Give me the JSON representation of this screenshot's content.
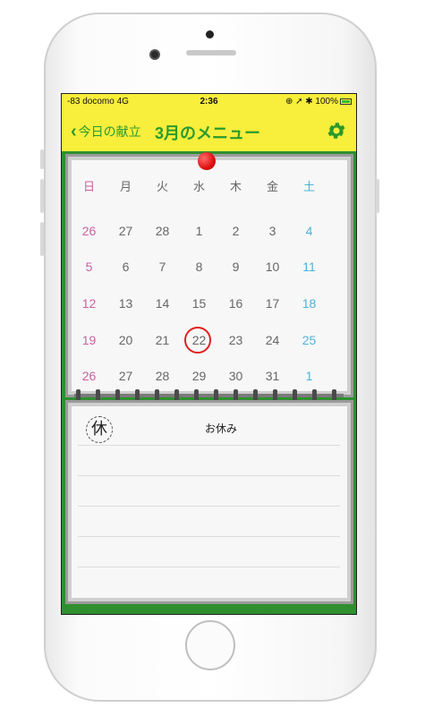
{
  "status_bar": {
    "carrier": "-83 docomo  4G",
    "time": "2:36",
    "icons_and_battery": "⊕ ➚ ✱ 100%"
  },
  "nav": {
    "back_label": "今日の献立",
    "title": "3月のメニュー",
    "settings_icon": "gear-icon"
  },
  "calendar": {
    "weekdays": [
      "日",
      "月",
      "火",
      "水",
      "木",
      "金",
      "土"
    ],
    "weeks": [
      [
        "26",
        "27",
        "28",
        "1",
        "2",
        "3",
        "4"
      ],
      [
        "5",
        "6",
        "7",
        "8",
        "9",
        "10",
        "11"
      ],
      [
        "12",
        "13",
        "14",
        "15",
        "16",
        "17",
        "18"
      ],
      [
        "19",
        "20",
        "21",
        "22",
        "23",
        "24",
        "25"
      ],
      [
        "26",
        "27",
        "28",
        "29",
        "30",
        "31",
        "1"
      ]
    ],
    "today": "22",
    "colors": {
      "sunday": "#cc5fa1",
      "saturday": "#4cb3d4",
      "today_ring": "#e02020"
    }
  },
  "day_detail": {
    "badge": "休",
    "label": "お休み"
  },
  "theme": {
    "bar": "#f8ee3c",
    "accent": "#2b9a2b",
    "background": "#2f8f2f"
  }
}
